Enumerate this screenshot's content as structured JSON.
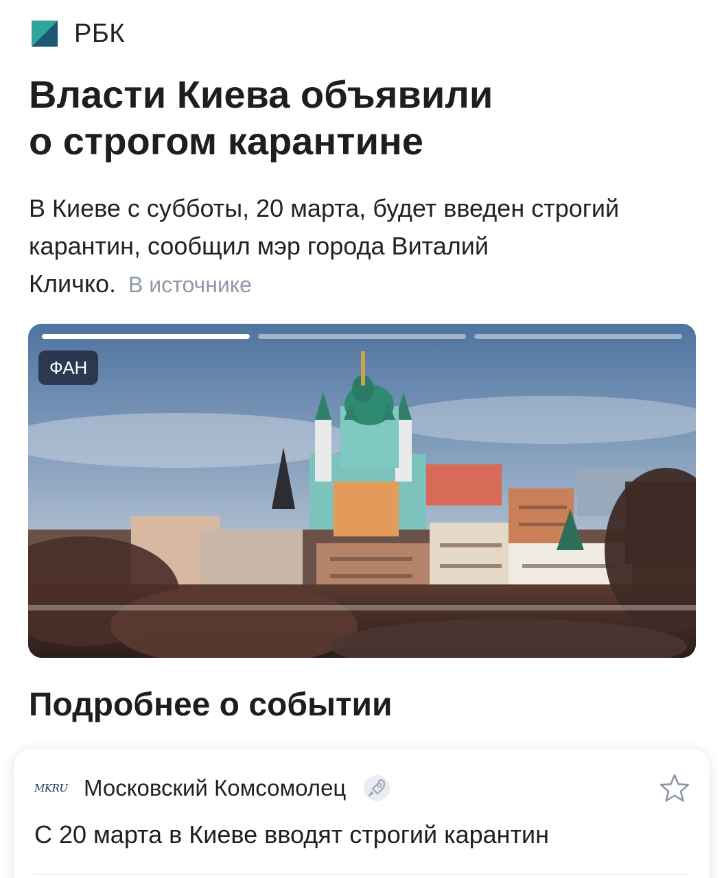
{
  "source": {
    "name": "РБК",
    "logo_icon": "rbc-logo-icon",
    "logo_colors": [
      "#2c9a8e",
      "#1b4f6e"
    ]
  },
  "article": {
    "headline_line1": "Власти Киева объявили",
    "headline_line2": "о строгом карантине",
    "lead_line1": "В Киеве с субботы, 20 марта, будет введен строгий",
    "lead_line2": "карантин, сообщил мэр города Виталий",
    "lead_line3": "Кличко.",
    "source_link": "В источнике"
  },
  "gallery": {
    "badge": "ФАН",
    "slides_total": 3,
    "active_slide": 1,
    "image_icon": "kyiv-andrew-church-photo"
  },
  "section": {
    "title": "Подробнее о событии"
  },
  "related": {
    "logo_text": "MKRU",
    "source_name": "Московский Комсомолец",
    "rocket_icon": "rocket-icon",
    "bookmark_icon": "star-icon",
    "title": "С 20 марта в Киеве вводят строгий карантин"
  }
}
